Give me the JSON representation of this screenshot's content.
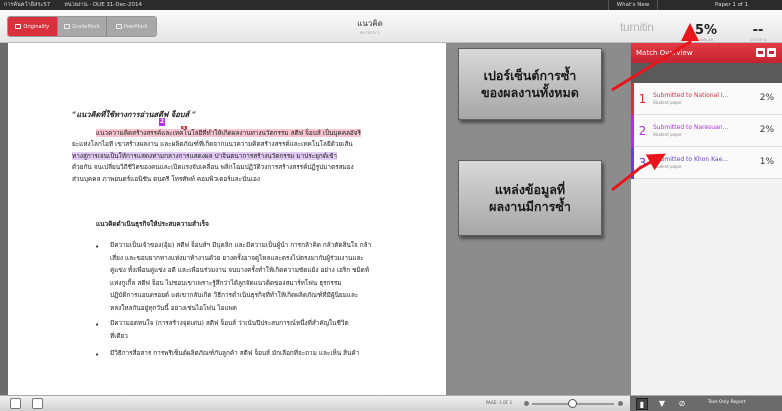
{
  "topbar": {
    "crumb": "การค้นคว้าอิสระ57",
    "due": "หน่วยงาน - DUE 31-Dec-2014",
    "whats_new": "What's New",
    "page_of": "Paper 1 of 1"
  },
  "modes": [
    {
      "label": "Originality"
    },
    {
      "label": "GradeMark"
    },
    {
      "label": "PeerMark"
    }
  ],
  "document": {
    "title": "แนวคิด",
    "by": "BY TESTY 1",
    "heading": "“แนวคิดที่ใช้ทางการอ่านสตีฟ จ็อบส์ ”",
    "match_num_1": "1",
    "match_num_2": "2",
    "para1": [
      "แนวความคิดสร้างสรรค์และเทคโนโลยีที่ทำให้เกิดผลงานทางนวัตกรรม สตีฟ จ็อบส์ เป็นบุคคลอัจริ",
      "ยะแห่งโลกไอที เขาสร้างผลงาน และผลิตภัณฑ์ที่เกิดจากแนวความคิดสร้างสรรค์และเทคโนโลยีด้วยเส้น",
      "ทางสู่การเจนเป็นให้การแสดงท่ามกลางการแสดงผล ปาจินตนาการสร้างนวัตกรรม มาประยุกต์เข้า",
      "ด้วยกัน จนเปลี่ยนวิถีชีวิตของคนและเปิดแรงจับเคลื่อน พลิกโฉมปฏิวัติวงการสร้างสรรค์ปฏิรูปมาตรสมอง",
      "ส่วนบุคคล ภาพยนตร์แอนิชัน ดนตรี โทรศัพท์ คอมพิวเตอร์และนั่นเอง"
    ],
    "section": "แนวคิดดำเนินธุรกิจให้ประสบความสำเร็จ",
    "bullet1": [
      "มีความเป็นเจ้าของ(อุ้ม) สตีฟ จ็อบส์ฯ มีบุคลิก และมีความเป็นผู้นำ การกล้าคิด กล้าตัดสินใจ กล้า",
      "เสี่ยง และขอบยากทางแห่งมาท้างานด้วย ยางครั้งอาจดูไหลและดรงไปตรงมากับผู้ร่วมงานและ",
      "คู่แข่ง ทั้งเพื่อนคู่แข่ง อดี และเพื่อนร่วมงาน จนบางครั้งทำให้เกิดความขัดแย้ง อย่าง เอริก ชมิดท์",
      "แห่งกูเกิ้ล สตีฟ จ็อบ ไม่ชอบเขาเพราะรู้สึกว่าได้ลูกจัดแนวคิดของสมาร์ทโฟน ธุรกรรม",
      "ปฏิบัติการแอนดรอยด์ แต่เขากลับเกิด วิธีการดำเนินธุรกิจที่ทำให้เกิดผลิตภัณฑ์ที่มีผู้นิยมและ",
      "หลงใหลกันอยู่ทุกวันนี้ อย่างเช่นไอโฟน ไอแพด"
    ],
    "bullet2": [
      "มีความอดทนใจ (การสร้างจุดเด่น) สตีฟ จ็อบส์ ว่าเน้นปีประสบการณ์หนึ่งที่สำคัญในชีวิต",
      "ที่เดียว"
    ],
    "bullet3": [
      "มีวิธีการสื่อสาร การพรีเซ็นต์ผลิตภัณฑ์กับลูกค้า สตีฟ จ็อบส์ มักเลือกที่จะถาม และเห็น สินค้า"
    ],
    "bullet_char": "•"
  },
  "callouts": {
    "c1": [
      "เปอร์เซ็นต์การซ้ำ",
      "ของผลงานทั้งหมด"
    ],
    "c2": [
      "แหล่งข้อมูลที่",
      "ผลงานมีการซ้ำ"
    ]
  },
  "brand": "turnitin",
  "similarity": {
    "value": "5%",
    "label": "SIMILAR"
  },
  "out_of": {
    "value": "--",
    "label": "OUT OF 0"
  },
  "match_overview": {
    "title": "Match Overview",
    "items": [
      {
        "num": "1",
        "source": "Submitted to National I...",
        "type": "Student paper",
        "percent": "2%",
        "color": "#d8303d"
      },
      {
        "num": "2",
        "source": "Submitted to Naresuan...",
        "type": "Student paper",
        "percent": "2%",
        "color": "#b32fe0"
      },
      {
        "num": "3",
        "source": "Submitted to Khon Kae...",
        "type": "Student paper",
        "percent": "1%",
        "color": "#6a3fd0"
      }
    ]
  },
  "bottombar": {
    "page_label": "PAGE: 1 OF 1",
    "text_only": "Text-Only Report"
  }
}
